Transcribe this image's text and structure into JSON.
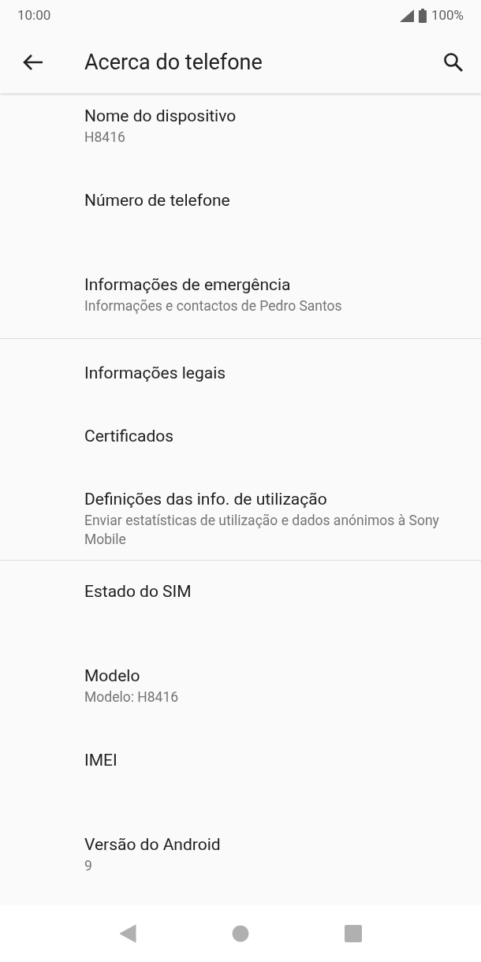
{
  "status_bar": {
    "time": "10:00",
    "battery": "100%"
  },
  "app_bar": {
    "title": "Acerca do telefone"
  },
  "groups": [
    {
      "kind": "tall",
      "items": [
        {
          "title": "Nome do dispositivo",
          "summary": "H8416"
        },
        {
          "title": "Número de telefone"
        },
        {
          "title": "Informações de emergência",
          "summary": "Informações e contactos de Pedro Santos"
        }
      ]
    },
    {
      "kind": "compact",
      "items": [
        {
          "title": "Informações legais"
        },
        {
          "title": "Certificados"
        },
        {
          "title": "Definições das info. de utilização",
          "summary": "Enviar estatísticas de utilização e dados anónimos à Sony Mobile"
        }
      ]
    },
    {
      "kind": "tall",
      "items": [
        {
          "title": "Estado do SIM"
        },
        {
          "title": "Modelo",
          "summary": "Modelo: H8416"
        },
        {
          "title": "IMEI"
        },
        {
          "title": "Versão do Android",
          "summary": "9"
        }
      ]
    }
  ]
}
